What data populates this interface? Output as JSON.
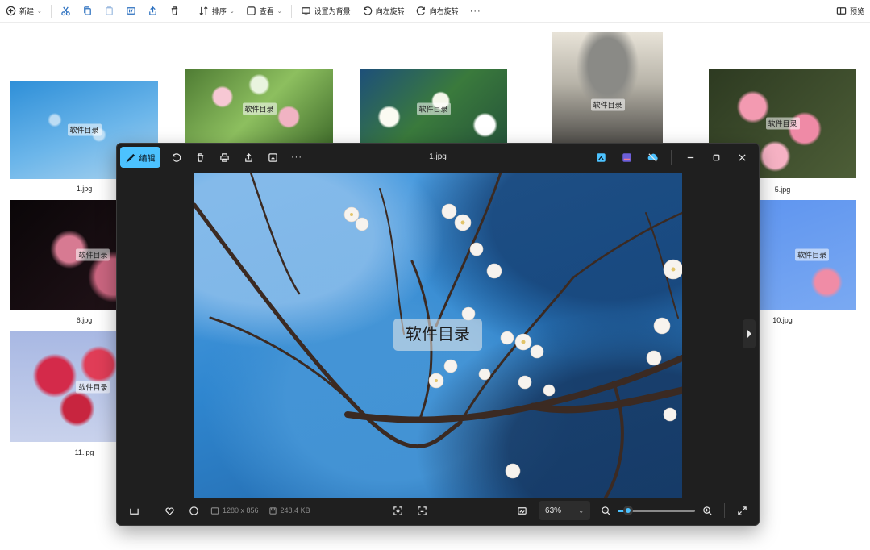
{
  "toolbar": {
    "new_label": "新建",
    "sort_label": "排序",
    "view_label": "查看",
    "set_bg_label": "设置为背景",
    "rotate_left_label": "向左旋转",
    "rotate_right_label": "向右旋转",
    "more_label": "···",
    "preview_label": "预览"
  },
  "thumbnails": [
    {
      "name": "1.jpg",
      "watermark": "软件目录"
    },
    {
      "name": "",
      "watermark": "软件目录"
    },
    {
      "name": "",
      "watermark": "软件目录"
    },
    {
      "name": "",
      "watermark": "软件目录"
    },
    {
      "name": "5.jpg",
      "watermark": "软件目录"
    },
    {
      "name": "6.jpg",
      "watermark": "软件目录"
    },
    {
      "name": "10.jpg",
      "watermark": "软件目录"
    },
    {
      "name": "11.jpg",
      "watermark": "软件目录"
    }
  ],
  "viewer": {
    "edit_label": "编辑",
    "title": "1.jpg",
    "more_label": "···",
    "watermark": "软件目录",
    "dimensions": "1280 x 856",
    "filesize": "248.4 KB",
    "zoom": "63%",
    "zoom_fraction": 0.14,
    "accent": "#4cc2ff"
  }
}
